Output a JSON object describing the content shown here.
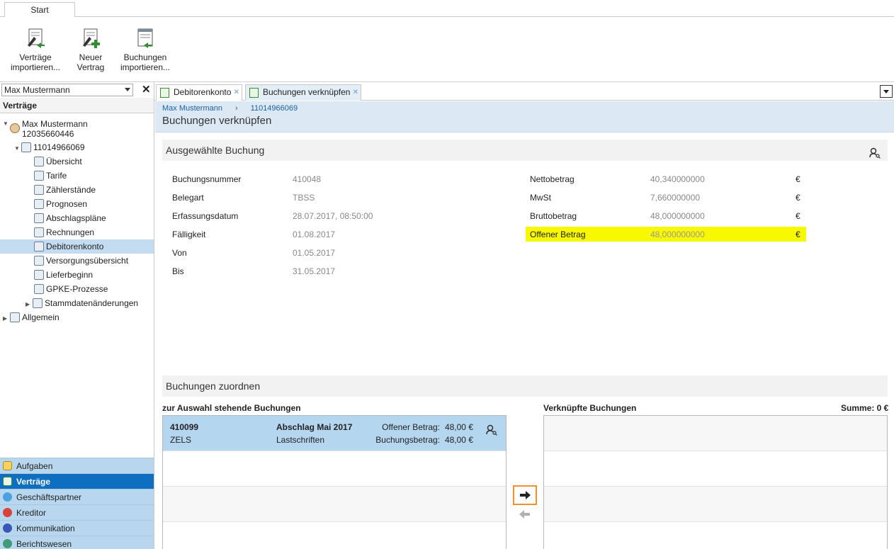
{
  "ribbon": {
    "tab": "Start",
    "buttons": [
      {
        "label_1": "Verträge",
        "label_2": "importieren..."
      },
      {
        "label_1": "Neuer",
        "label_2": "Vertrag"
      },
      {
        "label_1": "Buchungen",
        "label_2": "importieren..."
      }
    ]
  },
  "left": {
    "partner_select": "Max Mustermann",
    "close": "✕",
    "heading": "Verträge",
    "tree": {
      "person_name": "Max Mustermann",
      "person_id": "12035660446",
      "contract": "11014966069",
      "items": [
        "Übersicht",
        "Tarife",
        "Zählerstände",
        "Prognosen",
        "Abschlagspläne",
        "Rechnungen",
        "Debitorenkonto",
        "Versorgungsübersicht",
        "Lieferbeginn",
        "GPKE-Prozesse",
        "Stammdatenänderungen"
      ],
      "general": "Allgemein"
    },
    "nav": [
      "Aufgaben",
      "Verträge",
      "Geschäftspartner",
      "Kreditor",
      "Kommunikation",
      "Berichtswesen"
    ]
  },
  "tabs": [
    {
      "label": "Debitorenkonto",
      "close": "✕"
    },
    {
      "label": "Buchungen verknüpfen",
      "close": "✕"
    }
  ],
  "header": {
    "breadcrumb_1": "Max Mustermann",
    "breadcrumb_sep": "›",
    "breadcrumb_2": "11014966069",
    "title": "Buchungen verknüpfen"
  },
  "selected": {
    "heading": "Ausgewählte Buchung",
    "left_fields": [
      {
        "key": "Buchungsnummer",
        "value": "410048"
      },
      {
        "key": "Belegart",
        "value": "TBSS"
      },
      {
        "key": "Erfassungsdatum",
        "value": "28.07.2017, 08:50:00"
      },
      {
        "key": "Fälligkeit",
        "value": "01.08.2017"
      },
      {
        "key": "Von",
        "value": "01.05.2017"
      },
      {
        "key": "Bis",
        "value": "31.05.2017"
      }
    ],
    "right_fields": [
      {
        "key": "Nettobetrag",
        "value": "40,340000000",
        "unit": "€"
      },
      {
        "key": "MwSt",
        "value": "7,660000000",
        "unit": "€"
      },
      {
        "key": "Bruttobetrag",
        "value": "48,000000000",
        "unit": "€"
      },
      {
        "key": "Offener Betrag",
        "value": "48,000000000",
        "unit": "€"
      }
    ]
  },
  "assign": {
    "heading": "Buchungen zuordnen",
    "available_title": "zur Auswahl stehende Buchungen",
    "linked_title": "Verknüpfte Buchungen",
    "sum_label": "Summe: 0 €",
    "row": {
      "number": "410099",
      "type": "ZELS",
      "title": "Abschlag Mai 2017",
      "subtitle": "Lastschriften",
      "open_label": "Offener Betrag:",
      "open_value": "48,00 €",
      "booking_label": "Buchungsbetrag:",
      "booking_value": "48,00 €"
    }
  },
  "colors": {
    "highlight": "#f8f800",
    "nav_active": "#0e6fc1",
    "accent": "#f0912e"
  }
}
